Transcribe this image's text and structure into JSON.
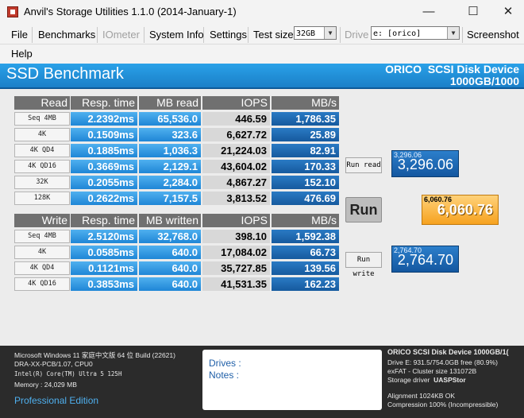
{
  "window": {
    "title": "Anvil's Storage Utilities 1.1.0 (2014-January-1)",
    "minimize": "—",
    "maximize": "☐",
    "close": "✕"
  },
  "menu": {
    "file": "File",
    "benchmarks": "Benchmarks",
    "iometer": "IOmeter",
    "system_info": "System Info",
    "settings": "Settings",
    "test_size_label": "Test size",
    "test_size_value": "32GB",
    "drive_label": "Drive",
    "drive_value": "e: [orico]",
    "screenshot": "Screenshot",
    "help": "Help"
  },
  "header": {
    "title": "SSD Benchmark",
    "device": "ORICO  SCSI Disk Device\n1000GB/1000"
  },
  "read_table": {
    "headers": [
      "Read",
      "Resp. time",
      "MB read",
      "IOPS",
      "MB/s"
    ],
    "rows": [
      {
        "label": "Seq 4MB",
        "resp": "2.2392ms",
        "mb": "65,536.0",
        "iops": "446.59",
        "mbs": "1,786.35"
      },
      {
        "label": "4K",
        "resp": "0.1509ms",
        "mb": "323.6",
        "iops": "6,627.72",
        "mbs": "25.89"
      },
      {
        "label": "4K QD4",
        "resp": "0.1885ms",
        "mb": "1,036.3",
        "iops": "21,224.03",
        "mbs": "82.91"
      },
      {
        "label": "4K QD16",
        "resp": "0.3669ms",
        "mb": "2,129.1",
        "iops": "43,604.02",
        "mbs": "170.33"
      },
      {
        "label": "32K",
        "resp": "0.2055ms",
        "mb": "2,284.0",
        "iops": "4,867.27",
        "mbs": "152.10"
      },
      {
        "label": "128K",
        "resp": "0.2622ms",
        "mb": "7,157.5",
        "iops": "3,813.52",
        "mbs": "476.69"
      }
    ]
  },
  "write_table": {
    "headers": [
      "Write",
      "Resp. time",
      "MB written",
      "IOPS",
      "MB/s"
    ],
    "rows": [
      {
        "label": "Seq 4MB",
        "resp": "2.5120ms",
        "mb": "32,768.0",
        "iops": "398.10",
        "mbs": "1,592.38"
      },
      {
        "label": "4K",
        "resp": "0.0585ms",
        "mb": "640.0",
        "iops": "17,084.02",
        "mbs": "66.73"
      },
      {
        "label": "4K QD4",
        "resp": "0.1121ms",
        "mb": "640.0",
        "iops": "35,727.85",
        "mbs": "139.56"
      },
      {
        "label": "4K QD16",
        "resp": "0.3853ms",
        "mb": "640.0",
        "iops": "41,531.35",
        "mbs": "162.23"
      }
    ]
  },
  "controls": {
    "run_read": "Run read",
    "run_write": "Run write",
    "run": "Run"
  },
  "scores": {
    "read_small": "3,296.06",
    "read_big": "3,296.06",
    "total_small": "6,060.76",
    "total_big": "6,060.76",
    "write_small": "2,764.70",
    "write_big": "2,764.70"
  },
  "system": {
    "os": "Microsoft Windows 11 家庭中文版 64 位 Build (22621)",
    "board": "DRA-XX-PCB/1.07, CPU0",
    "cpu": "Intel(R) Core(TM) Ultra 5 125H",
    "memory": "Memory : 24,029 MB",
    "edition": "Professional Edition"
  },
  "notes": {
    "drives": "Drives :",
    "notes": "Notes :"
  },
  "device_info": {
    "name": "ORICO  SCSI Disk Device 1000GB/1(",
    "drive": "Drive E: 931.5/754.0GB free (80.9%)",
    "fs": "exFAT - Cluster size 131072B",
    "driver_label": "Storage driver",
    "driver": "UASPStor",
    "alignment": "Alignment 1024KB OK",
    "compression": "Compression 100% (Incompressible)"
  },
  "colors": {
    "header_blue": "#1a8ad8",
    "cell_blue": "#2a93e0",
    "score_blue": "#1d66b3",
    "total_orange": "#f6a21f",
    "bottom_bg": "#2b2b2b"
  }
}
